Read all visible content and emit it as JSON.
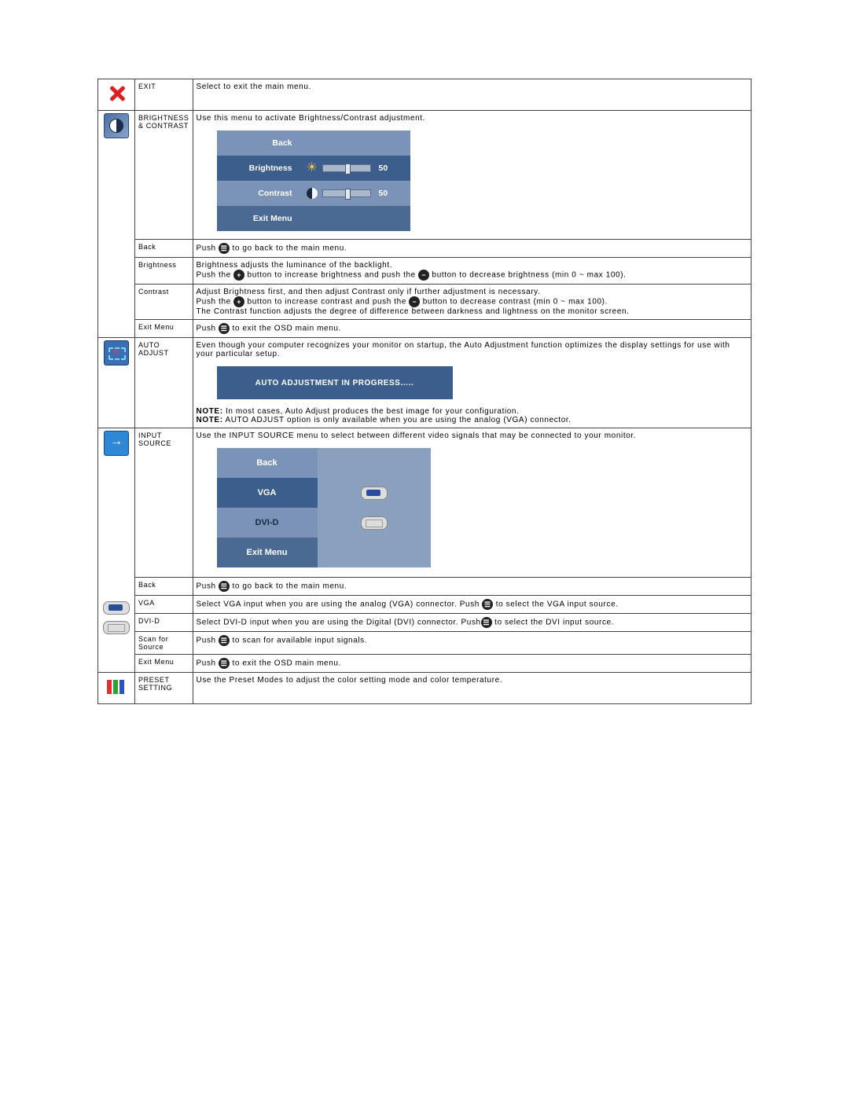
{
  "rows": {
    "exit": {
      "label": "EXIT",
      "desc": "Select to exit the main menu."
    },
    "brightness": {
      "label": "BRIGHTNESS & CONTRAST",
      "desc": "Use this menu to activate Brightness/Contrast adjustment.",
      "panel": {
        "back": "Back",
        "brightness": "Brightness",
        "contrast": "Contrast",
        "exitmenu": "Exit Menu",
        "bval": "50",
        "cval": "50"
      },
      "back": {
        "label": "Back",
        "desc_pre": "Push ",
        "desc_post": " to go back to the main menu."
      },
      "bright_row": {
        "label": "Brightness",
        "line1": "Brightness adjusts the luminance of the backlight.",
        "line2_pre": "Push the ",
        "line2_mid": " button to increase brightness and push the ",
        "line2_post": " button to decrease brightness (min 0 ~ max 100)."
      },
      "contrast_row": {
        "label": "Contrast",
        "line1": "Adjust Brightness first, and then adjust Contrast only if further adjustment is necessary.",
        "line2_pre": "Push the ",
        "line2_mid": " button to increase contrast and push the ",
        "line2_post": " button to decrease contrast (min 0 ~ max 100).",
        "line3": "The Contrast function adjusts the degree of difference between darkness and lightness on the monitor screen."
      },
      "exitmenu_row": {
        "label": "Exit Menu",
        "desc_pre": "Push ",
        "desc_post": " to exit the OSD main menu."
      }
    },
    "auto": {
      "label": "AUTO ADJUST",
      "desc": "Even though your computer recognizes your monitor on startup, the Auto Adjustment function optimizes the display settings for use with your particular setup.",
      "banner": "AUTO ADJUSTMENT IN PROGRESS…..",
      "note1_b": "NOTE:",
      "note1": " In most cases, Auto Adjust produces the best image for your configuration.",
      "note2_b": "NOTE:",
      "note2": " AUTO ADJUST option is only available when you are using the analog (VGA) connector."
    },
    "input": {
      "label": "INPUT SOURCE",
      "desc": "Use the INPUT SOURCE menu to select between different video signals that may be connected to your monitor.",
      "panel": {
        "back": "Back",
        "vga": "VGA",
        "dvi": "DVI-D",
        "exit": "Exit Menu"
      },
      "back": {
        "label": "Back",
        "pre": "Push ",
        "post": " to go back to the main menu."
      },
      "vga": {
        "label": "VGA",
        "pre": "Select VGA input when you are using the analog (VGA) connector. Push ",
        "post": " to select the VGA input source."
      },
      "dvi": {
        "label": "DVI-D",
        "pre": "Select DVI-D input when you are using the Digital (DVI) connector. Push",
        "post": " to select the DVI input source."
      },
      "scan": {
        "label": "Scan for Source",
        "pre": "Push ",
        "post": " to scan for available input signals."
      },
      "exit": {
        "label": "Exit Menu",
        "pre": "Push ",
        "post": " to exit the OSD main menu."
      }
    },
    "preset": {
      "label": "PRESET SETTING",
      "desc": "Use the Preset Modes to adjust the color setting mode and color temperature."
    }
  }
}
